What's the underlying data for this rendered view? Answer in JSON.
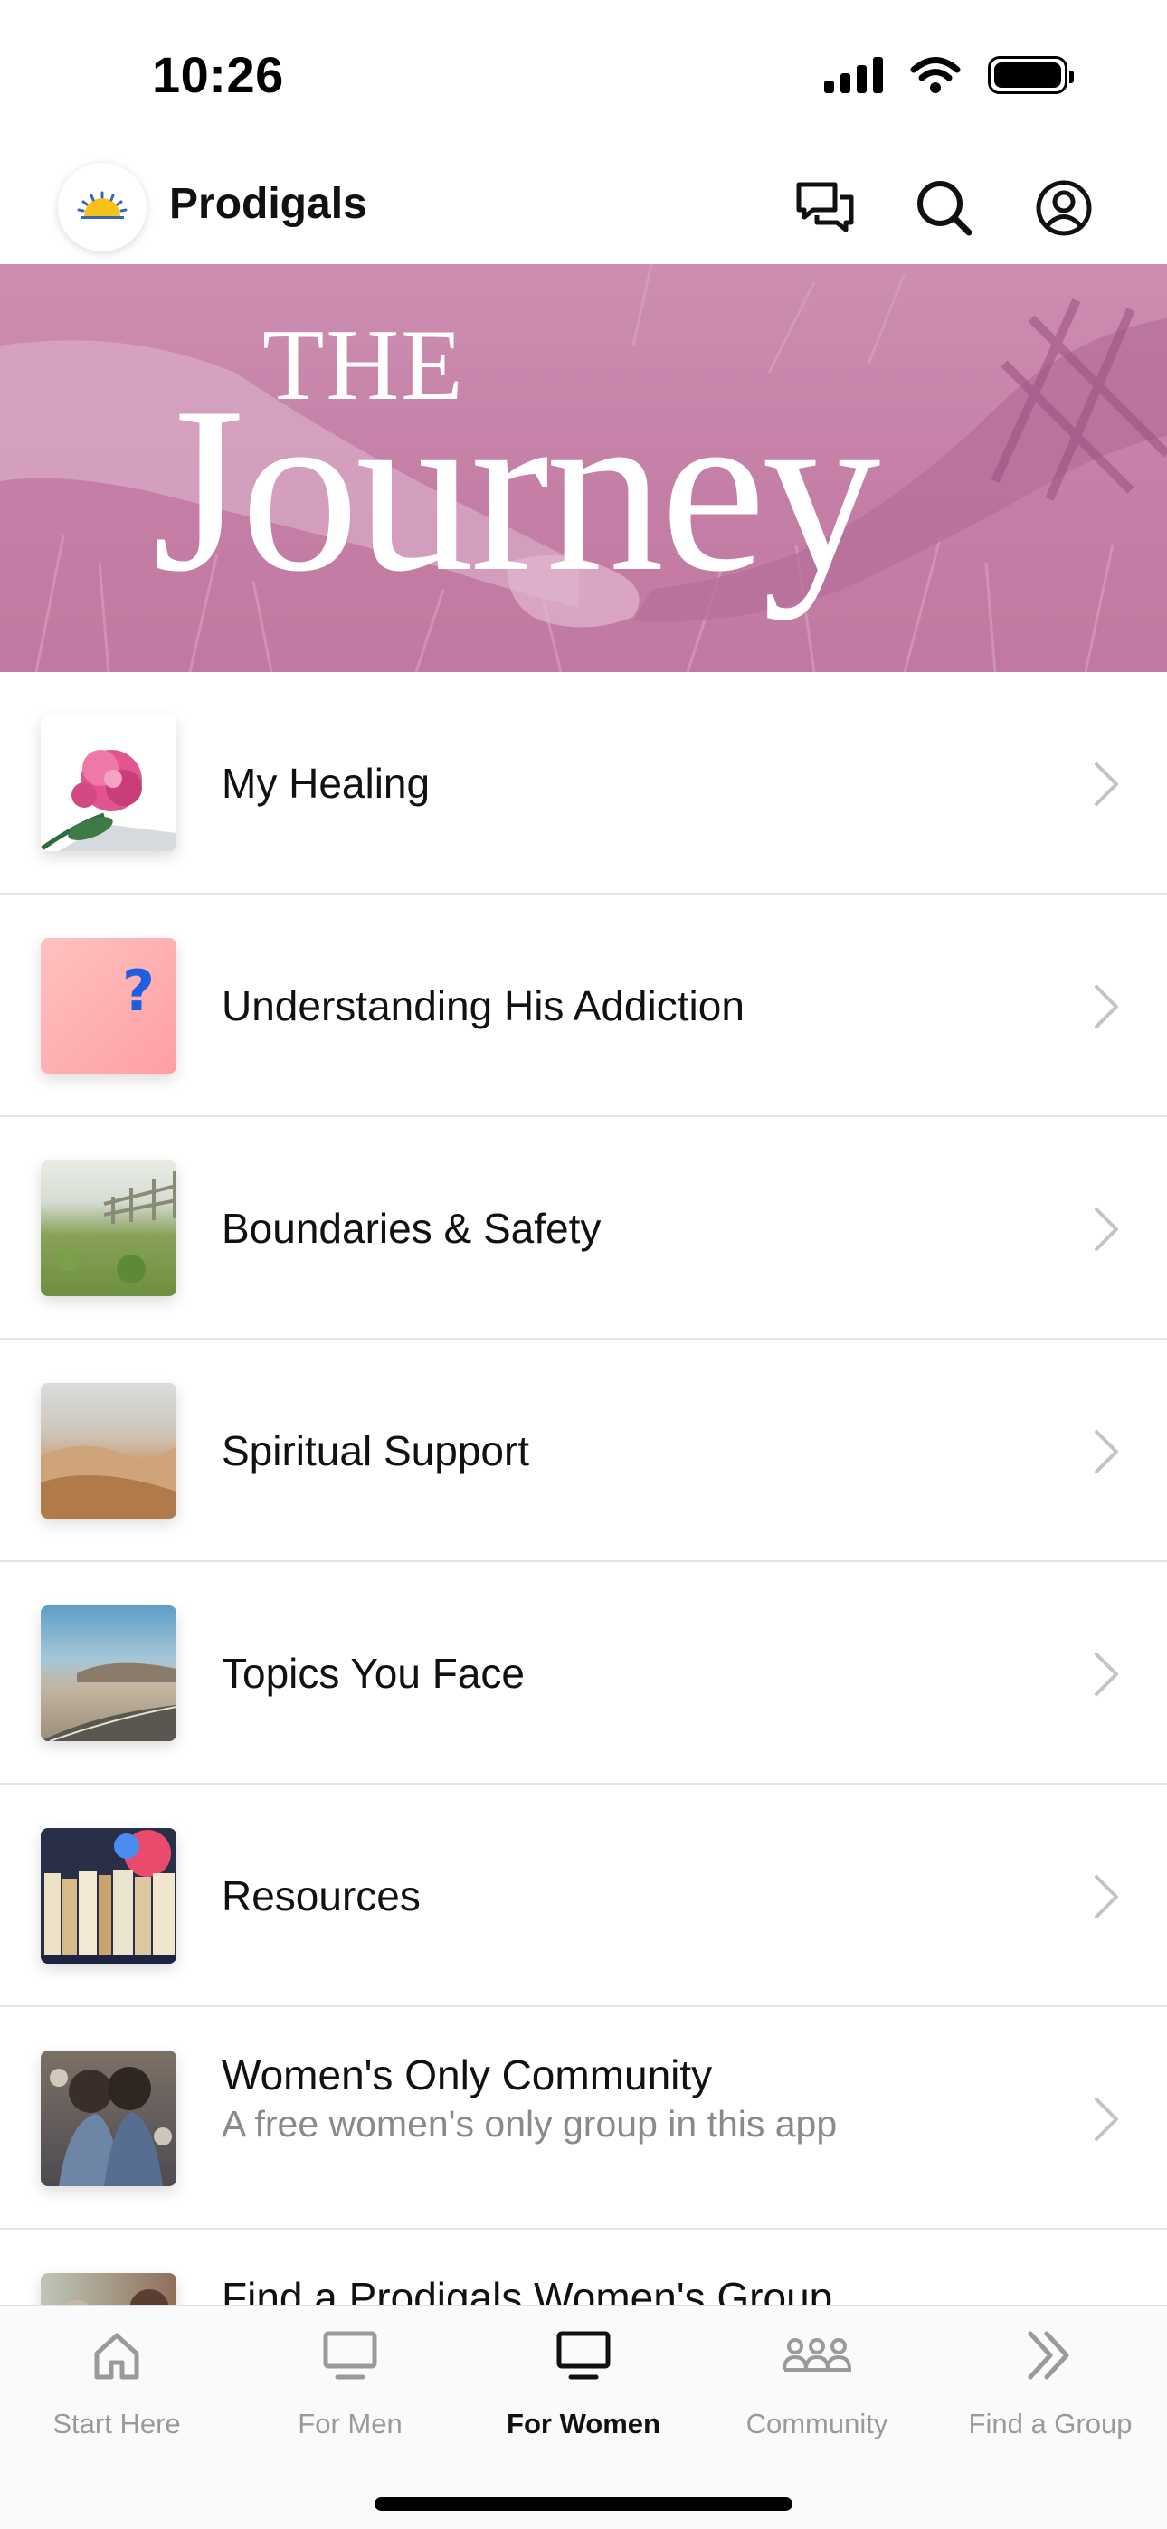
{
  "status_bar": {
    "time": "10:26"
  },
  "header": {
    "title": "Prodigals",
    "icons": [
      "chat-icon",
      "search-icon",
      "account-icon"
    ]
  },
  "hero": {
    "line1": "THE",
    "line2": "Journey"
  },
  "list": [
    {
      "title": "My Healing",
      "subtitle": ""
    },
    {
      "title": "Understanding His Addiction",
      "subtitle": ""
    },
    {
      "title": "Boundaries & Safety",
      "subtitle": ""
    },
    {
      "title": "Spiritual Support",
      "subtitle": ""
    },
    {
      "title": "Topics You Face",
      "subtitle": ""
    },
    {
      "title": "Resources",
      "subtitle": ""
    },
    {
      "title": "Women's Only Community",
      "subtitle": "A free women's only group in this app"
    },
    {
      "title": "Find a Prodigals Women's Group",
      "subtitle": ""
    }
  ],
  "tabs": [
    {
      "label": "Start Here",
      "icon": "home-icon",
      "active": false
    },
    {
      "label": "For Men",
      "icon": "monitor-icon",
      "active": false
    },
    {
      "label": "For Women",
      "icon": "monitor-icon",
      "active": true
    },
    {
      "label": "Community",
      "icon": "people-icon",
      "active": false
    },
    {
      "label": "Find a Group",
      "icon": "double-chevron-icon",
      "active": false
    }
  ],
  "colors": {
    "hero": "#c57fa6",
    "active_tab": "#111111",
    "inactive_tab": "#9a9a9a"
  }
}
